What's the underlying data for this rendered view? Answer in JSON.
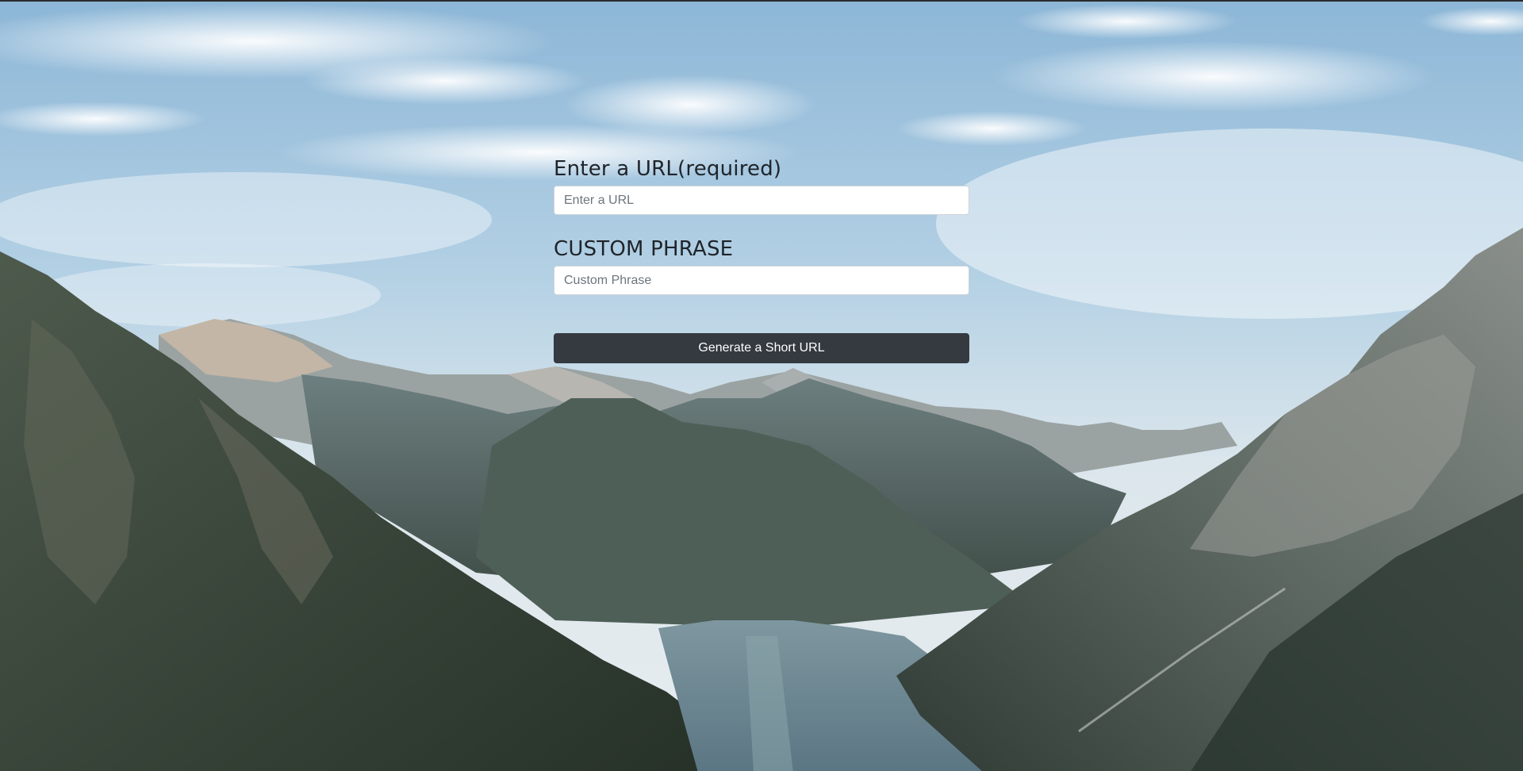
{
  "form": {
    "url_label": "Enter a URL(required)",
    "url_placeholder": "Enter a URL",
    "url_value": "",
    "custom_label": "CUSTOM PHRASE",
    "custom_placeholder": "Custom Phrase",
    "custom_value": "",
    "submit_label": "Generate a Short URL"
  },
  "colors": {
    "button_bg": "#343a40",
    "label_text": "#1f2429",
    "sky_top": "#8fb8d6",
    "mountain_dark": "#34443c"
  }
}
